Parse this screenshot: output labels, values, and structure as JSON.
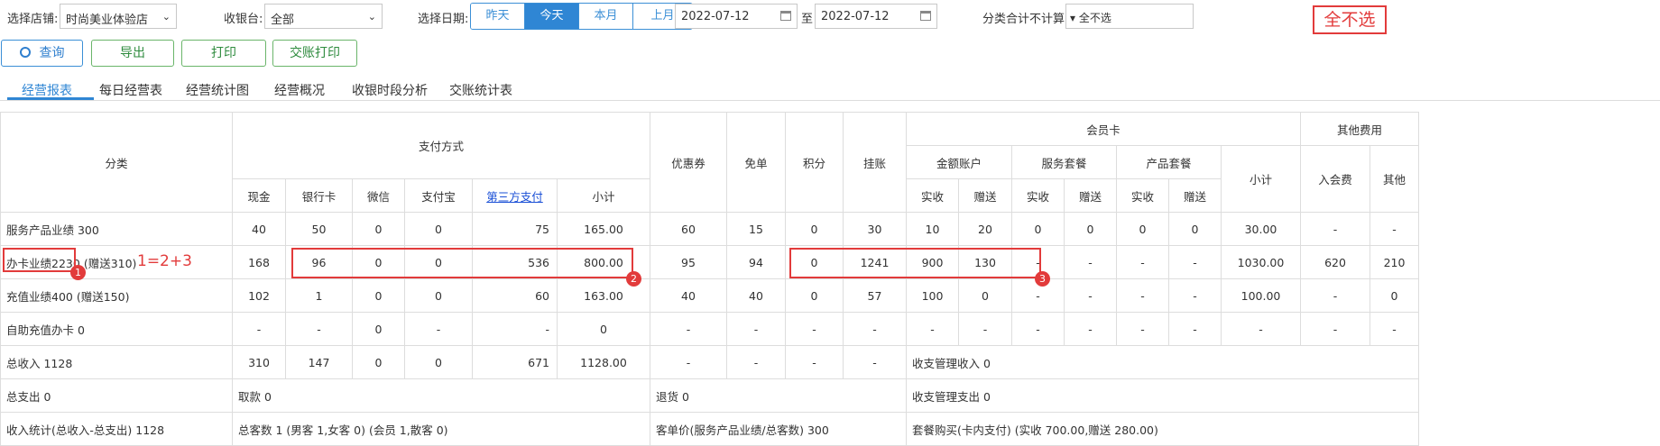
{
  "toolbar": {
    "store_label": "选择店铺:",
    "store_value": "时尚美业体验店",
    "register_label": "收银台:",
    "register_value": "全部",
    "date_label": "选择日期:",
    "date_ranges": [
      "昨天",
      "今天",
      "本月",
      "上月"
    ],
    "active_range": "今天",
    "date_from": "2022-07-12",
    "date_to_sep": "至",
    "date_to": "2022-07-12",
    "exclude_label": "分类合计不计算:",
    "exclude_value": "▾ 全不选",
    "exclude_annotation": "全不选"
  },
  "actions": {
    "query": "查询",
    "export": "导出",
    "print": "打印",
    "handover_print": "交账打印"
  },
  "tabs": [
    "经营报表",
    "每日经营表",
    "经营统计图",
    "经营概况",
    "收银时段分析",
    "交账统计表"
  ],
  "active_tab": "经营报表",
  "table": {
    "h_category": "分类",
    "h_payment": "支付方式",
    "h_cash": "现金",
    "h_bank": "银行卡",
    "h_wechat": "微信",
    "h_alipay": "支付宝",
    "h_third": "第三方支付",
    "h_subtotal": "小计",
    "h_coupon": "优惠券",
    "h_free": "免单",
    "h_points": "积分",
    "h_credit": "挂账",
    "h_member": "会员卡",
    "h_amount_acct": "金额账户",
    "h_service_pkg": "服务套餐",
    "h_product_pkg": "产品套餐",
    "h_actual": "实收",
    "h_gift": "赠送",
    "h_member_sub": "小计",
    "h_other_fee": "其他费用",
    "h_join_fee": "入会费",
    "h_other": "其他",
    "rows": [
      {
        "cat": "服务产品业绩 300",
        "cells": [
          "40",
          "50",
          "0",
          "0",
          "75",
          "165.00",
          "60",
          "15",
          "0",
          "30",
          "10",
          "20",
          "0",
          "0",
          "0",
          "0",
          "30.00",
          "-",
          "-"
        ]
      },
      {
        "cat": "办卡业绩2230",
        "cat_extra": "(赠送310)",
        "cells": [
          "168",
          "96",
          "0",
          "0",
          "536",
          "800.00",
          "95",
          "94",
          "0",
          "1241",
          "900",
          "130",
          "-",
          "-",
          "-",
          "-",
          "1030.00",
          "620",
          "210"
        ]
      },
      {
        "cat": "充值业绩400 (赠送150)",
        "cells": [
          "102",
          "1",
          "0",
          "0",
          "60",
          "163.00",
          "40",
          "40",
          "0",
          "57",
          "100",
          "0",
          "-",
          "-",
          "-",
          "-",
          "100.00",
          "-",
          "0"
        ]
      },
      {
        "cat": "自助充值办卡 0",
        "cells": [
          "-",
          "-",
          "0",
          "-",
          "-",
          "0",
          "-",
          "-",
          "-",
          "-",
          "-",
          "-",
          "-",
          "-",
          "-",
          "-",
          "-",
          "-",
          "-"
        ]
      },
      {
        "cat": "总收入 1128",
        "cells": [
          "310",
          "147",
          "0",
          "0",
          "671",
          "1128.00",
          "-",
          "-",
          "-",
          "-"
        ],
        "tail": "收支管理收入 0"
      }
    ],
    "summary_expense": {
      "a": "总支出 0",
      "b": "取款 0",
      "c": "退货 0",
      "d": "收支管理支出 0"
    },
    "summary_stats": {
      "a": "收入统计(总收入-总支出) 1128",
      "b": "总客数 1 (男客 1,女客 0) (会员 1,散客 0)",
      "c": "客单价(服务产品业绩/总客数) 300",
      "d": "套餐购买(卡内支付) (实收 700.00,赠送 280.00)"
    }
  },
  "annotations": {
    "formula": "1=2+3",
    "badge1": "1",
    "badge2": "2",
    "badge3": "3",
    "color": "#e23b3b"
  }
}
